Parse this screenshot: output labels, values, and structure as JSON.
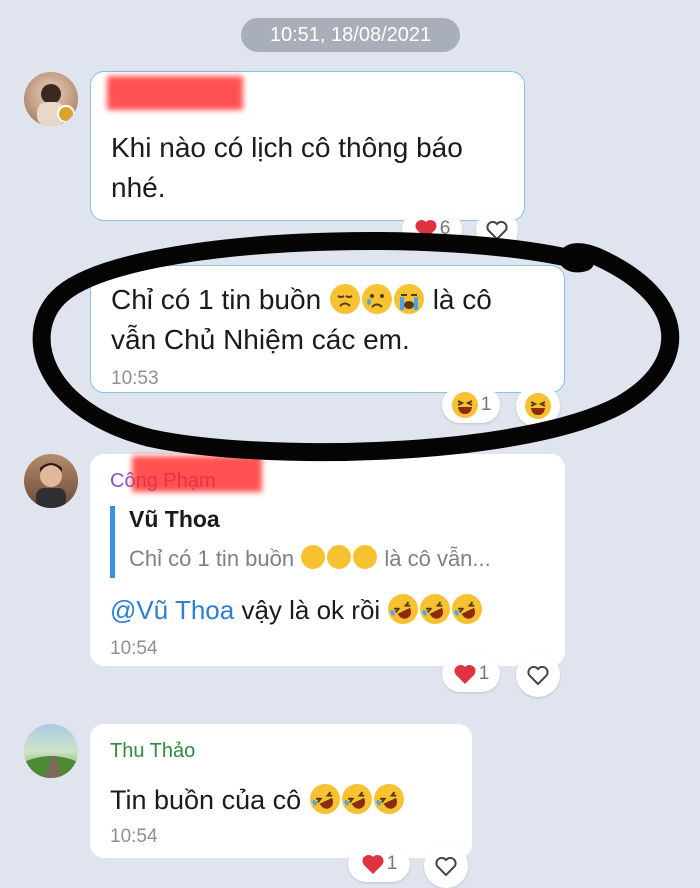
{
  "date_label": "10:51, 18/08/2021",
  "colors": {
    "background": "#dfe4ee",
    "mention": "#2d7fd6",
    "bubble_border": "#7fc6df",
    "quote_bar": "#3d8ee8"
  },
  "messages": [
    {
      "sender": "",
      "text_lines": [
        "Khi nào có lịch cô thông báo",
        "nhé."
      ],
      "reaction": {
        "icon": "heart-icon",
        "count": "6"
      }
    },
    {
      "text_parts": [
        "Chỉ có 1 tin buồn",
        "là cô",
        "vẫn Chủ Nhiệm các em."
      ],
      "time": "10:53",
      "reaction": {
        "icon": "laugh-emoji-icon",
        "count": "1"
      }
    },
    {
      "sender": "Công Phạm",
      "quote_name": "Vũ Thoa",
      "quote_text_a": "Chỉ có 1 tin buồn",
      "quote_text_b": "là cô vẫn...",
      "mention": "@Vũ Thoa",
      "text": "vậy là ok rồi",
      "time": "10:54",
      "reaction": {
        "icon": "heart-icon",
        "count": "1"
      }
    },
    {
      "sender": "Thu Thảo",
      "text": "Tin buồn của cô",
      "time": "10:54",
      "reaction": {
        "icon": "heart-icon",
        "count": "1"
      }
    }
  ]
}
